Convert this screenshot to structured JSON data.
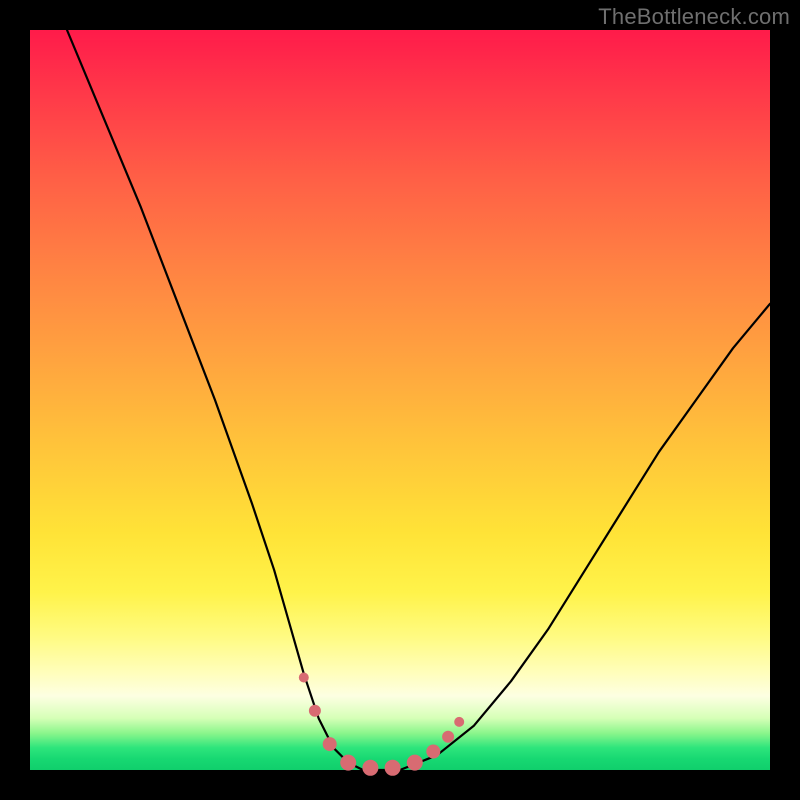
{
  "watermark": "TheBottleneck.com",
  "chart_data": {
    "type": "line",
    "title": "",
    "xlabel": "",
    "ylabel": "",
    "xlim": [
      0,
      100
    ],
    "ylim": [
      0,
      100
    ],
    "series": [
      {
        "name": "bottleneck-curve",
        "x": [
          5,
          10,
          15,
          20,
          25,
          30,
          33,
          35,
          37,
          39,
          41,
          43,
          45,
          47,
          50,
          55,
          60,
          65,
          70,
          75,
          80,
          85,
          90,
          95,
          100
        ],
        "y": [
          100,
          88,
          76,
          63,
          50,
          36,
          27,
          20,
          13,
          7,
          3,
          1,
          0,
          0,
          0,
          2,
          6,
          12,
          19,
          27,
          35,
          43,
          50,
          57,
          63
        ]
      }
    ],
    "markers": {
      "name": "highlight-dots",
      "color": "#d86b72",
      "points": [
        {
          "x": 37.0,
          "y": 12.5,
          "r": 5
        },
        {
          "x": 38.5,
          "y": 8.0,
          "r": 6
        },
        {
          "x": 40.5,
          "y": 3.5,
          "r": 7
        },
        {
          "x": 43.0,
          "y": 1.0,
          "r": 8
        },
        {
          "x": 46.0,
          "y": 0.3,
          "r": 8
        },
        {
          "x": 49.0,
          "y": 0.3,
          "r": 8
        },
        {
          "x": 52.0,
          "y": 1.0,
          "r": 8
        },
        {
          "x": 54.5,
          "y": 2.5,
          "r": 7
        },
        {
          "x": 56.5,
          "y": 4.5,
          "r": 6
        },
        {
          "x": 58.0,
          "y": 6.5,
          "r": 5
        }
      ]
    },
    "background_gradient": {
      "top": "#ff1b4a",
      "mid_upper": "#ff8243",
      "mid": "#ffe337",
      "lower": "#fffebd",
      "bottom": "#10cf6c"
    }
  }
}
